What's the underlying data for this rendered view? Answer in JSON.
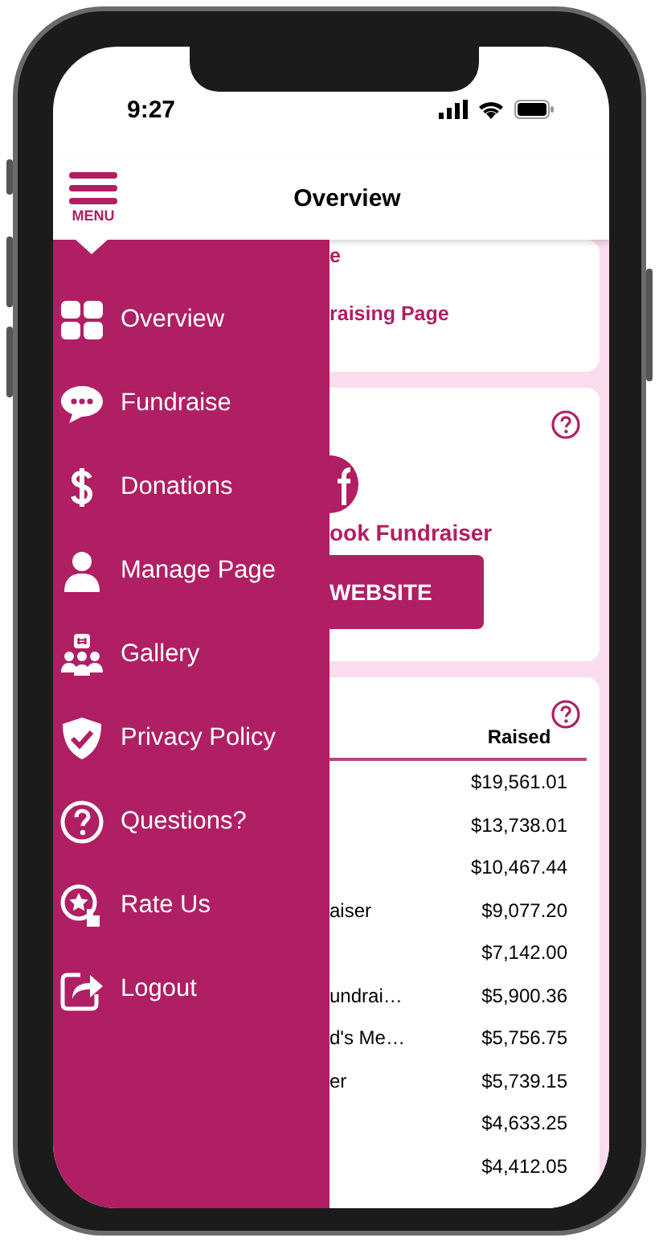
{
  "status_bar": {
    "time": "9:27"
  },
  "header": {
    "menu_label": "MENU",
    "title": "Overview"
  },
  "menu": {
    "items": [
      {
        "label": "Overview"
      },
      {
        "label": "Fundraise"
      },
      {
        "label": "Donations"
      },
      {
        "label": "Manage Page"
      },
      {
        "label": "Gallery"
      },
      {
        "label": "Privacy Policy"
      },
      {
        "label": "Questions?"
      },
      {
        "label": "Rate Us"
      },
      {
        "label": "Logout"
      }
    ]
  },
  "page_card": {
    "line_1": "e",
    "link": "raising Page"
  },
  "facebook_card": {
    "title": "ook Fundraiser",
    "button": "WEBSITE"
  },
  "leaderboard": {
    "columns": [
      "Raised"
    ],
    "rows": [
      {
        "raised": "$19,561.01"
      },
      {
        "raised": "$13,738.01"
      },
      {
        "raised": "$10,467.44"
      },
      {
        "column_1": "aiser",
        "raised": "$9,077.20"
      },
      {
        "raised": "$7,142.00"
      },
      {
        "column_1": "undrai…",
        "raised": "$5,900.36"
      },
      {
        "column_1": "d's Me…",
        "raised": "$5,756.75"
      },
      {
        "column_1": "er",
        "raised": "$5,739.15"
      },
      {
        "raised": "$4,633.25"
      },
      {
        "raised": "$4,412.05"
      }
    ]
  }
}
